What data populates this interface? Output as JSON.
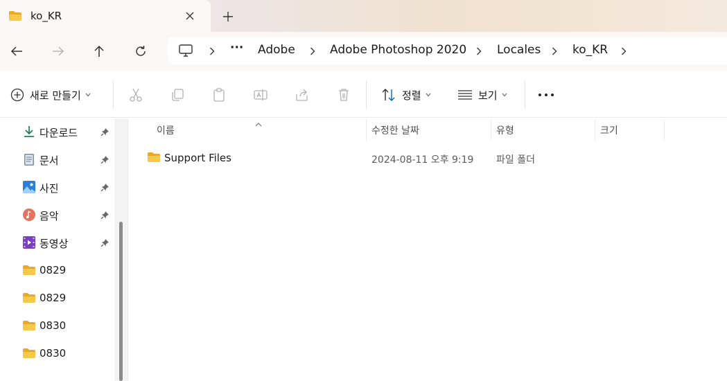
{
  "tab": {
    "title": "ko_KR"
  },
  "address": {
    "overflow": "···",
    "crumbs": [
      "Adobe",
      "Adobe Photoshop 2020",
      "Locales",
      "ko_KR"
    ]
  },
  "toolbar": {
    "new_label": "새로 만들기",
    "sort_label": "정렬",
    "view_label": "보기",
    "more_label": "···"
  },
  "sidebar": {
    "items": [
      {
        "label": "다운로드",
        "icon": "download-icon",
        "pinned": true
      },
      {
        "label": "문서",
        "icon": "document-icon",
        "pinned": true
      },
      {
        "label": "사진",
        "icon": "pictures-icon",
        "pinned": true
      },
      {
        "label": "음악",
        "icon": "music-icon",
        "pinned": true
      },
      {
        "label": "동영상",
        "icon": "video-icon",
        "pinned": true
      },
      {
        "label": "0829",
        "icon": "folder-icon",
        "pinned": false
      },
      {
        "label": "0829",
        "icon": "folder-icon",
        "pinned": false
      },
      {
        "label": "0830",
        "icon": "folder-icon",
        "pinned": false
      },
      {
        "label": "0830",
        "icon": "folder-icon",
        "pinned": false
      }
    ]
  },
  "columns": {
    "name": "이름",
    "modified": "수정한 날짜",
    "type": "유형",
    "size": "크기"
  },
  "files": [
    {
      "name": "Support Files",
      "modified": "2024-08-11 오후 9:19",
      "type": "파일 폴더",
      "size": ""
    }
  ],
  "colors": {
    "accent": "#0067c0",
    "folder": "#f8c84a",
    "folder_dark": "#e9a92c"
  }
}
